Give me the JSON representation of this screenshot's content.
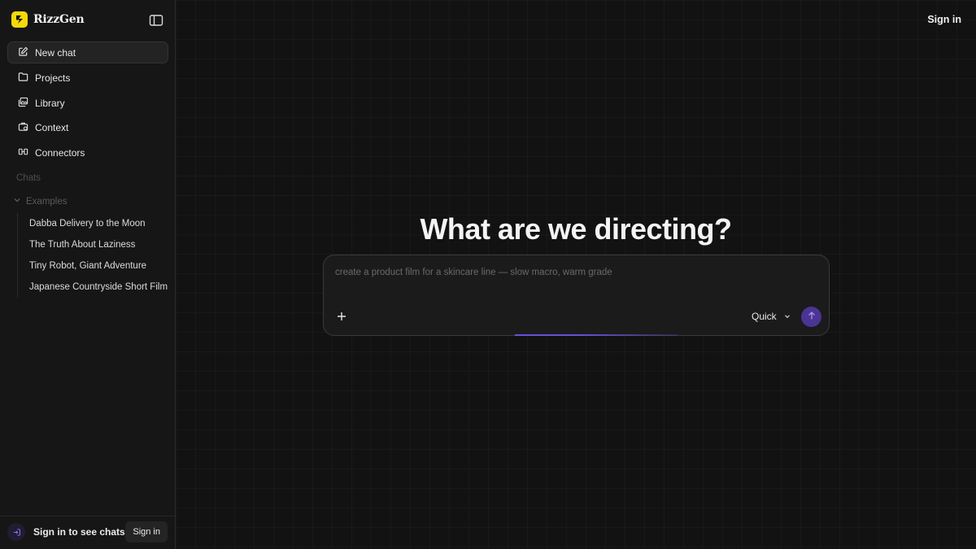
{
  "brand": {
    "name": "RizzGen"
  },
  "nav": {
    "items": [
      {
        "label": "New chat",
        "icon": "edit-icon"
      },
      {
        "label": "Projects",
        "icon": "folder-icon"
      },
      {
        "label": "Library",
        "icon": "images-icon"
      },
      {
        "label": "Context",
        "icon": "briefcase-icon"
      },
      {
        "label": "Connectors",
        "icon": "connector-icon"
      }
    ]
  },
  "sidebar": {
    "chats_label": "Chats",
    "examples_label": "Examples",
    "examples": [
      "Dabba Delivery to the Moon",
      "The Truth About Laziness",
      "Tiny Robot, Giant Adventure",
      "Japanese Countryside Short Film"
    ],
    "footer_text": "Sign in to see chats",
    "footer_button": "Sign in"
  },
  "header": {
    "sign_in": "Sign in"
  },
  "main": {
    "headline": "What are we directing?",
    "composer": {
      "placeholder": "create a product film for a skincare line — slow macro, warm grade",
      "mode": "Quick"
    }
  },
  "colors": {
    "accent": "#4b3494",
    "brand_yellow": "#f5d90a",
    "background": "#121212"
  }
}
